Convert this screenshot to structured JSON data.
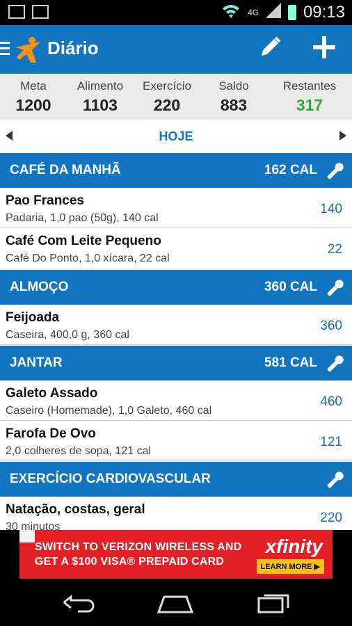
{
  "status": {
    "time": "09:13",
    "network": "4G"
  },
  "app": {
    "title": "Diário"
  },
  "summary": [
    {
      "label": "Meta",
      "value": "1200"
    },
    {
      "label": "Alimento",
      "value": "1103"
    },
    {
      "label": "Exercício",
      "value": "220"
    },
    {
      "label": "Saldo",
      "value": "883"
    },
    {
      "label": "Restantes",
      "value": "317"
    }
  ],
  "day": {
    "label": "HOJE"
  },
  "sections": [
    {
      "name": "CAFÉ DA MANHÃ",
      "calories": "162 CAL"
    },
    {
      "name": "ALMOÇO",
      "calories": "360 CAL"
    },
    {
      "name": "JANTAR",
      "calories": "581 CAL"
    },
    {
      "name": "EXERCÍCIO CARDIOVASCULAR",
      "calories": ""
    }
  ],
  "entries": [
    {
      "title": "Pao Frances",
      "subtitle": "Padaria, 1,0 pao (50g), 140 cal",
      "calories": "140"
    },
    {
      "title": "Café Com Leite Pequeno",
      "subtitle": "Café Do Ponto, 1,0 xícara, 22 cal",
      "calories": "22"
    },
    {
      "title": "Feijoada",
      "subtitle": "Caseira, 400,0 g, 360 cal",
      "calories": "360"
    },
    {
      "title": "Galeto Assado",
      "subtitle": "Caseiro (Homemade), 1,0 Galeto, 460 cal",
      "calories": "460"
    },
    {
      "title": "Farofa De Ovo",
      "subtitle": "2,0 colheres de sopa, 121 cal",
      "calories": "121"
    },
    {
      "title": "Natação, costas, geral",
      "subtitle": "30 minutos",
      "calories": "220"
    }
  ],
  "ad": {
    "line1": "SWITCH TO VERIZON WIRELESS AND",
    "line2": "GET A $100 VISA® PREPAID CARD",
    "brand": "xfinity",
    "cta": "LEARN MORE ▶"
  },
  "colors": {
    "primary": "#1175c2",
    "positive": "#3aa63a",
    "ad": "#e41f26"
  }
}
